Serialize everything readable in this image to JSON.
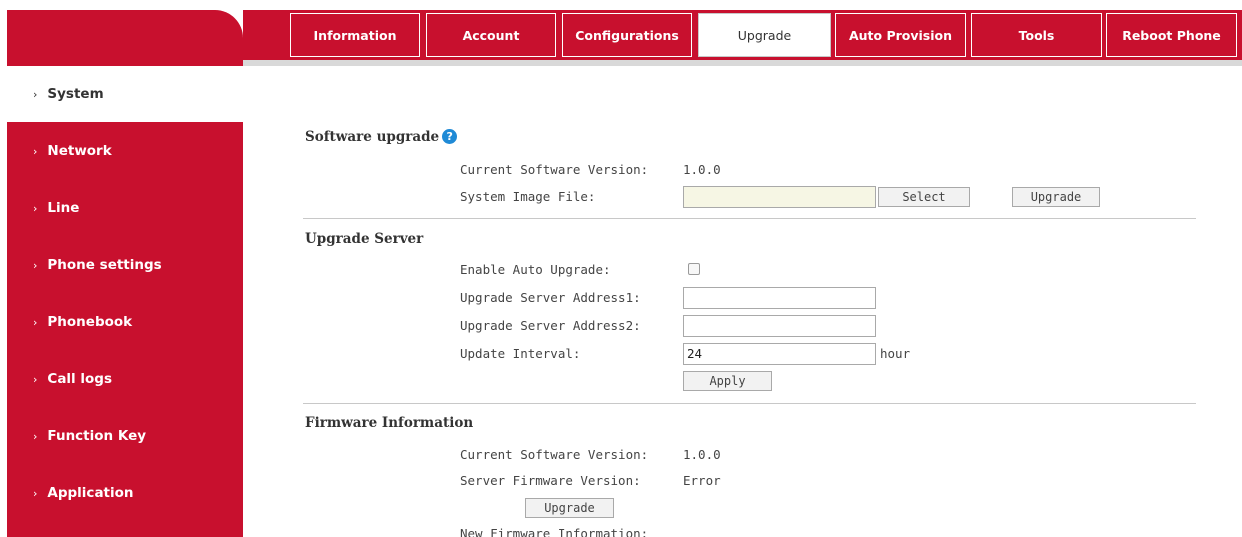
{
  "sidebar": {
    "items": [
      {
        "label": "System",
        "active": true
      },
      {
        "label": "Network"
      },
      {
        "label": "Line"
      },
      {
        "label": "Phone settings"
      },
      {
        "label": "Phonebook"
      },
      {
        "label": "Call logs"
      },
      {
        "label": "Function Key"
      },
      {
        "label": "Application"
      }
    ],
    "chevron": "›"
  },
  "tabs": [
    {
      "label": "Information"
    },
    {
      "label": "Account"
    },
    {
      "label": "Configurations"
    },
    {
      "label": "Upgrade",
      "active": true
    },
    {
      "label": "Auto Provision"
    },
    {
      "label": "Tools"
    },
    {
      "label": "Reboot Phone"
    }
  ],
  "software_upgrade": {
    "title": "Software upgrade",
    "help_icon": "?",
    "current_version_label": "Current Software Version:",
    "current_version_value": "1.0.0",
    "system_image_label": "System Image File:",
    "system_image_value": "",
    "select_button": "Select",
    "upgrade_button": "Upgrade"
  },
  "upgrade_server": {
    "title": "Upgrade Server",
    "enable_auto_label": "Enable Auto Upgrade:",
    "enable_auto_checked": false,
    "address1_label": "Upgrade Server Address1:",
    "address1_value": "",
    "address2_label": "Upgrade Server Address2:",
    "address2_value": "",
    "interval_label": "Update Interval:",
    "interval_value": "24",
    "interval_unit": "hour",
    "apply_button": "Apply"
  },
  "firmware_info": {
    "title": "Firmware Information",
    "current_version_label": "Current Software Version:",
    "current_version_value": "1.0.0",
    "server_version_label": "Server Firmware Version:",
    "server_version_value": "Error",
    "upgrade_button": "Upgrade",
    "new_info_label": "New Firmware Information:"
  },
  "colors": {
    "brand_red": "#c8102e",
    "help_blue": "#1f8ad6"
  }
}
